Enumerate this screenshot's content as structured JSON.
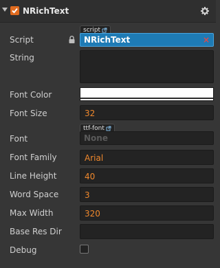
{
  "component": {
    "title": "NRichText",
    "enabled": true
  },
  "fields": {
    "script": {
      "label": "Script",
      "tag": "script",
      "value": "NRichText",
      "clear": "×"
    },
    "string": {
      "label": "String",
      "value": ""
    },
    "font_color": {
      "label": "Font Color",
      "value": "#ffffff"
    },
    "font_size": {
      "label": "Font Size",
      "value": "32"
    },
    "font": {
      "label": "Font",
      "tag": "ttf-font",
      "value": "None"
    },
    "font_family": {
      "label": "Font Family",
      "value": "Arial"
    },
    "line_height": {
      "label": "Line Height",
      "value": "40"
    },
    "word_space": {
      "label": "Word Space",
      "value": "3"
    },
    "max_width": {
      "label": "Max Width",
      "value": "320"
    },
    "base_res_dir": {
      "label": "Base Res Dir",
      "value": ""
    },
    "debug": {
      "label": "Debug",
      "checked": false
    }
  },
  "colors": {
    "accent": "#e06b1f",
    "number": "#f0882c",
    "script_bg": "#1e7bb5"
  },
  "icons": [
    "collapse-triangle",
    "checkbox-checked",
    "gear",
    "lock",
    "external-link",
    "clear-x"
  ]
}
